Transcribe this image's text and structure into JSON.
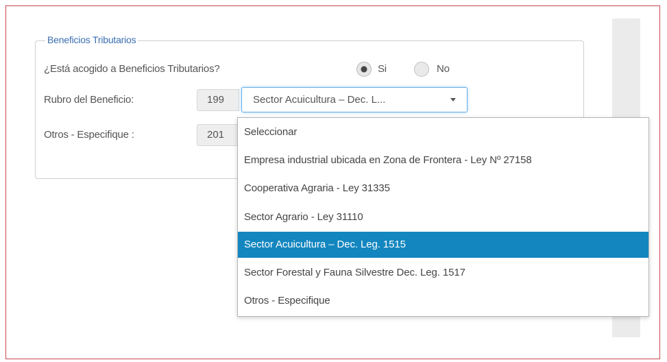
{
  "fieldset": {
    "legend": "Beneficios Tributarios"
  },
  "question": {
    "label": "¿Está acogido a Beneficios Tributarios?",
    "options": [
      {
        "label": "Si",
        "checked": true
      },
      {
        "label": "No",
        "checked": false
      }
    ]
  },
  "rubro": {
    "label": "Rubro del Beneficio:",
    "code": "199",
    "selected_display": "Sector Acuicultura – Dec. L...",
    "dropdown_icon": "caret-down-icon"
  },
  "otros": {
    "label": "Otros - Especifique :",
    "code": "201"
  },
  "dropdown": {
    "options": [
      "Seleccionar",
      "Empresa industrial ubicada en Zona de Frontera - Ley Nº 27158",
      "Cooperativa Agraria - Ley 31335",
      "Sector Agrario - Ley 31110",
      "Sector Acuicultura – Dec. Leg. 1515",
      "Sector Forestal y Fauna Silvestre Dec. Leg. 1517",
      "Otros - Especifique"
    ],
    "selected_option": "Sector Acuicultura – Dec. Leg. 1515",
    "highlight_color": "#1386bf"
  },
  "colors": {
    "frame_border": "#c9474e",
    "legend_text": "#3a6db1",
    "focus_border": "#66afe9",
    "side_strip": "#ebebeb"
  }
}
